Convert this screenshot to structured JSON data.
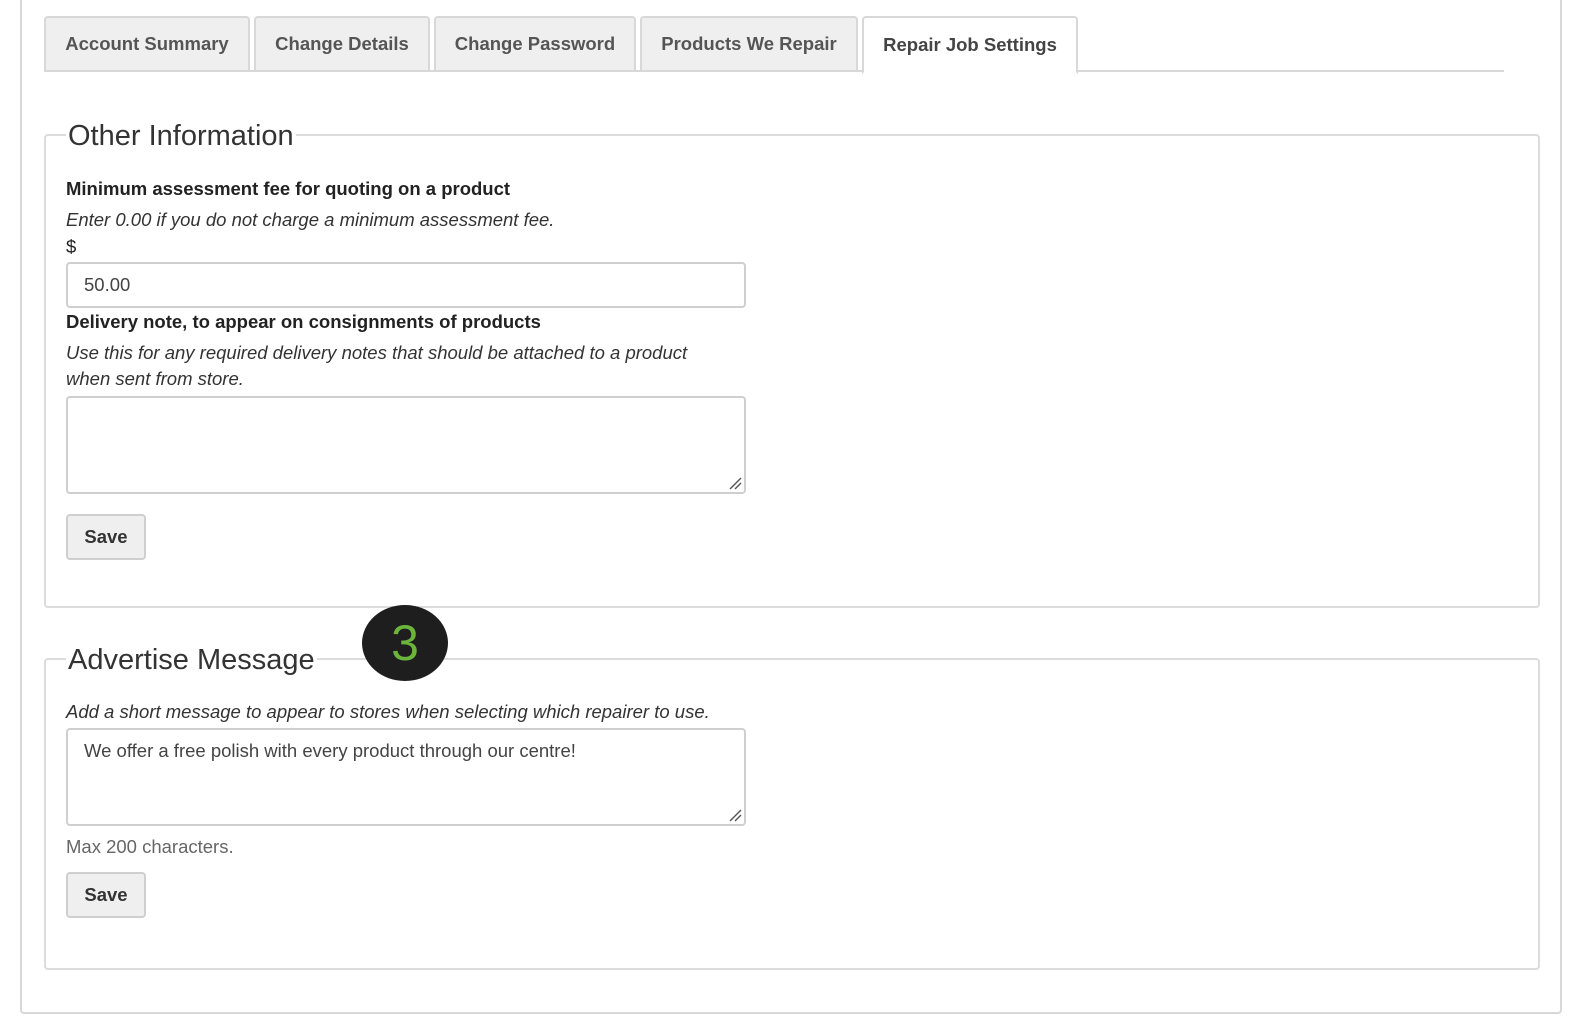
{
  "tabs": [
    {
      "label": "Account Summary",
      "active": false
    },
    {
      "label": "Change Details",
      "active": false
    },
    {
      "label": "Change Password",
      "active": false
    },
    {
      "label": "Products We Repair",
      "active": false
    },
    {
      "label": "Repair Job Settings",
      "active": true
    }
  ],
  "other_information": {
    "legend": "Other Information",
    "assessment_fee": {
      "label": "Minimum assessment fee for quoting on a product",
      "help": "Enter 0.00 if you do not charge a minimum assessment fee.",
      "currency_symbol": "$",
      "value": "50.00"
    },
    "delivery_note": {
      "label": "Delivery note, to appear on consignments of products",
      "help_line1": "Use this for any required delivery notes that should be attached to a product",
      "help_line2": "when sent from store.",
      "value": ""
    },
    "save_label": "Save"
  },
  "advertise_message": {
    "legend": "Advertise Message",
    "help": "Add a short message to appear to stores when selecting which repairer to use.",
    "value": "We offer a free polish with every product through our centre!",
    "limit_note": "Max 200 characters.",
    "save_label": "Save"
  },
  "step_badge": {
    "number": "3",
    "background": "#1e1e1e",
    "color": "#6bb53c"
  },
  "colors": {
    "tab_background": "#efefef",
    "border": "#d8d8d8",
    "button_background": "#efefef"
  }
}
